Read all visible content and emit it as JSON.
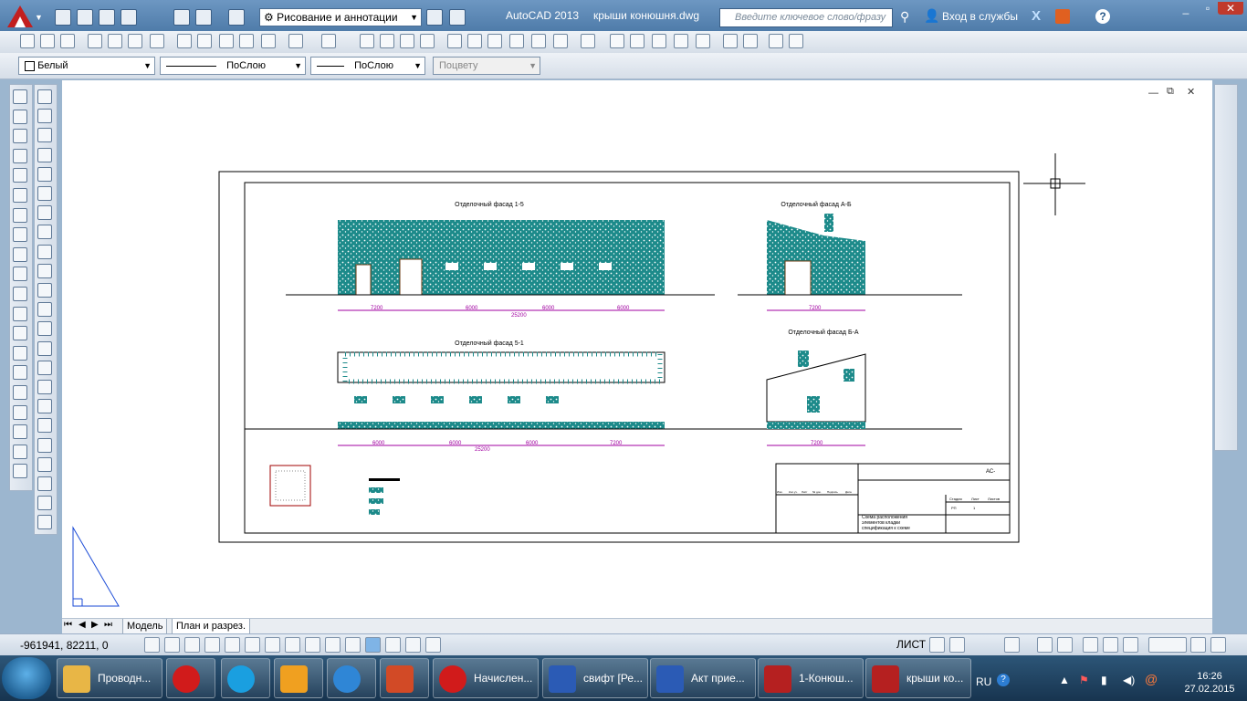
{
  "title_bar": {
    "workspace": "Рисование и аннотации",
    "app_name": "AutoCAD 2013",
    "file_name": "крыши конюшня.dwg",
    "search_placeholder": "Введите ключевое слово/фразу",
    "login": "Вход в службы"
  },
  "properties_bar": {
    "color": "Белый",
    "linetype": "ПоСлою",
    "lineweight": "ПоСлою",
    "plotstyle": "Поцвету"
  },
  "drawing": {
    "views": [
      {
        "title": "Отделочный фасад 1-5",
        "dims": [
          "7200",
          "6000",
          "6000",
          "6000"
        ],
        "total": "25200"
      },
      {
        "title": "Отделочный фасад А-Б",
        "dims": [
          "7200"
        ]
      },
      {
        "title": "Отделочный фасад 5-1",
        "dims": [
          "6000",
          "6000",
          "6000",
          "7200"
        ],
        "total": "25200"
      },
      {
        "title": "Отделочный фасад Б-А",
        "dims": [
          "7200"
        ]
      }
    ],
    "stamp": {
      "code": "АС-",
      "description_lines": [
        "Схема расположения",
        "элементов кладки",
        "спецификация к схеме"
      ],
      "stage_headers": [
        "Стадия",
        "Лист",
        "Листов"
      ],
      "stage": "РП",
      "sheet": "1",
      "table_headers": [
        "Изм.",
        "Кол.уч.",
        "Лист",
        "№ док.",
        "Подпись",
        "Дата"
      ]
    }
  },
  "tabs": {
    "model": "Модель",
    "layout": "План и разрез."
  },
  "status_bar": {
    "coords": "-961941, 82211, 0",
    "sheet": "ЛИСТ"
  },
  "taskbar": {
    "items": [
      {
        "label": "Проводн...",
        "icon": "explorer-icon"
      },
      {
        "label": "",
        "icon": "opera-icon"
      },
      {
        "label": "",
        "icon": "skype-icon"
      },
      {
        "label": "",
        "icon": "winamp-icon"
      },
      {
        "label": "",
        "icon": "ie-icon"
      },
      {
        "label": "",
        "icon": "powerpoint-icon"
      },
      {
        "label": "Начислен...",
        "icon": "opera-icon"
      },
      {
        "label": "свифт [Ре...",
        "icon": "word-icon"
      },
      {
        "label": "Акт прие...",
        "icon": "word-icon"
      },
      {
        "label": "1-Конюш...",
        "icon": "autocad-icon"
      },
      {
        "label": "крыши ко...",
        "icon": "autocad-icon"
      }
    ],
    "lang": "RU",
    "time": "16:26",
    "date": "27.02.2015"
  },
  "colors": {
    "accent": "#1f8a8a",
    "title_bar": "#5a86b3",
    "dimension": "#a000a0",
    "leader": "#0a6a2a"
  }
}
